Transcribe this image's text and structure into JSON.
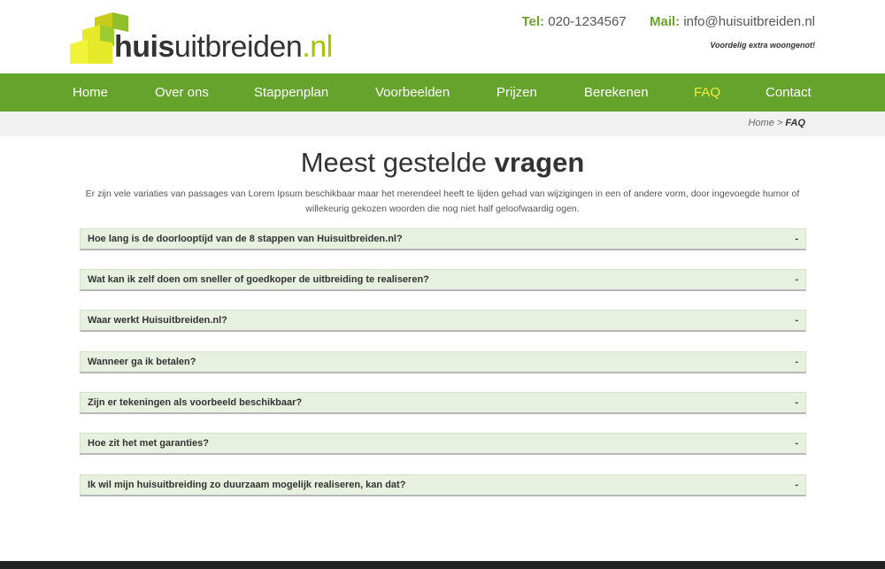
{
  "header": {
    "logo": {
      "name_bold": "huis",
      "name_rest": "uitbreiden",
      "name_ext": ".nl"
    },
    "tel_label": "Tel:",
    "tel_value": "020-1234567",
    "mail_label": "Mail:",
    "mail_value": "info@huisuitbreiden.nl",
    "tagline": "Voordelig extra woongenot!"
  },
  "nav": {
    "items": [
      {
        "label": "Home"
      },
      {
        "label": "Over ons"
      },
      {
        "label": "Stappenplan"
      },
      {
        "label": "Voorbeelden"
      },
      {
        "label": "Prijzen"
      },
      {
        "label": "Berekenen"
      },
      {
        "label": "FAQ"
      },
      {
        "label": "Contact"
      }
    ],
    "active_color": "#f0ee3c"
  },
  "breadcrumb": {
    "home": "Home",
    "separator": ">",
    "current": "FAQ"
  },
  "main": {
    "title_light": "Meest gestelde",
    "title_bold": "vragen",
    "intro": "Er zijn vele variaties van passages van Lorem Ipsum beschikbaar maar het merendeel heeft te lijden gehad van wijzigingen in een of andere vorm, door ingevoegde humor of willekeurig gekozen woorden die nog niet half geloofwaardig ogen.",
    "faqs": [
      {
        "question": "Hoe lang is de doorlooptijd van de 8 stappen van Huisuitbreiden.nl?",
        "toggle": "-"
      },
      {
        "question": "Wat kan ik zelf doen om sneller of goedkoper de uitbreiding te realiseren?",
        "toggle": "-"
      },
      {
        "question": "Waar werkt Huisuitbreiden.nl?",
        "toggle": "-"
      },
      {
        "question": "Wanneer ga ik betalen?",
        "toggle": "-"
      },
      {
        "question": "Zijn er tekeningen als voorbeeld beschikbaar?",
        "toggle": "-"
      },
      {
        "question": "Hoe zit het met garanties?",
        "toggle": "-"
      },
      {
        "question": "Ik wil mijn huisuitbreiding zo duurzaam mogelijk realiseren, kan dat?",
        "toggle": "-"
      }
    ]
  },
  "colors": {
    "brand_green": "#65a32c",
    "logo_yellow": "#e6e82a",
    "faq_bg": "#e8f1e0"
  }
}
